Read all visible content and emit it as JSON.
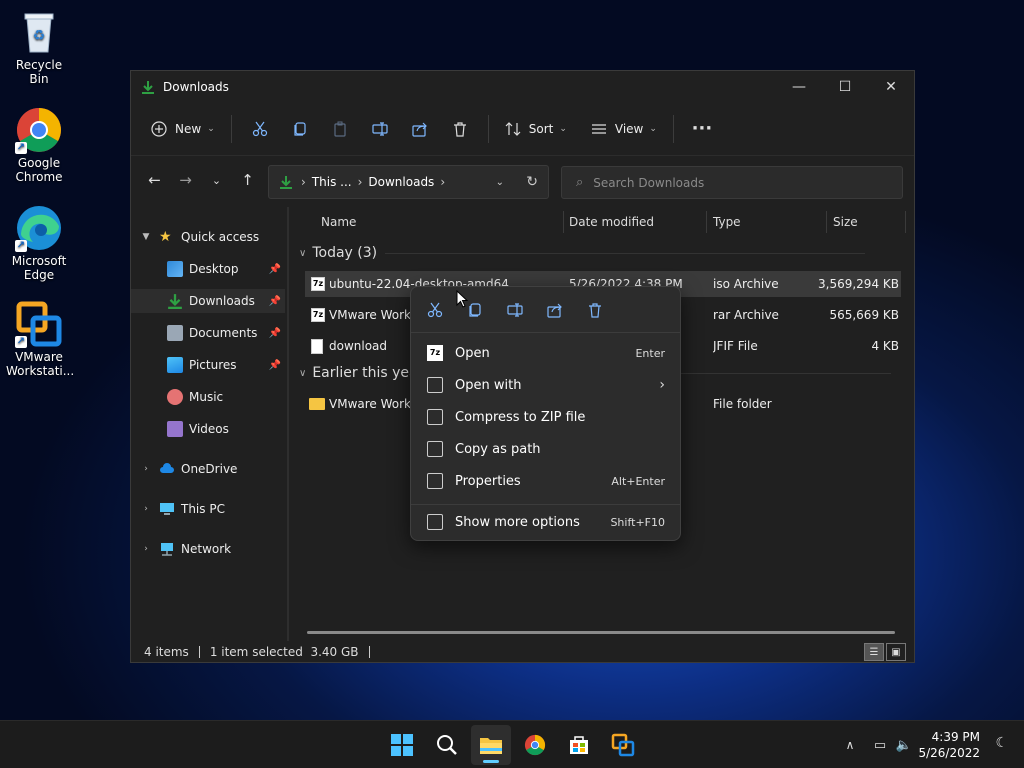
{
  "desktop": {
    "icons": [
      {
        "label": "Recycle Bin"
      },
      {
        "label": "Google Chrome"
      },
      {
        "label": "Microsoft Edge"
      },
      {
        "label": "VMware Workstati..."
      }
    ]
  },
  "window": {
    "title": "Downloads",
    "toolbar": {
      "new_label": "New",
      "sort_label": "Sort",
      "view_label": "View"
    },
    "address": {
      "crumb1": "This ...",
      "crumb2": "Downloads"
    },
    "search": {
      "placeholder": "Search Downloads"
    },
    "sidebar": {
      "quick_access": "Quick access",
      "items": [
        {
          "label": "Desktop"
        },
        {
          "label": "Downloads"
        },
        {
          "label": "Documents"
        },
        {
          "label": "Pictures"
        },
        {
          "label": "Music"
        },
        {
          "label": "Videos"
        }
      ],
      "onedrive": "OneDrive",
      "thispc": "This PC",
      "network": "Network"
    },
    "columns": {
      "name": "Name",
      "date": "Date modified",
      "type": "Type",
      "size": "Size"
    },
    "groups": {
      "today": "Today (3)",
      "earlier": "Earlier this year"
    },
    "files": [
      {
        "name": "ubuntu-22.04-desktop-amd64",
        "date": "5/26/2022 4:38 PM",
        "type": "iso Archive",
        "size": "3,569,294 KB"
      },
      {
        "name": "VMware Workst",
        "date": "",
        "type": "rar Archive",
        "size": "565,669 KB"
      },
      {
        "name": "download",
        "date": "",
        "type": "JFIF File",
        "size": "4 KB"
      },
      {
        "name": "VMware Workst",
        "date": "",
        "type": "File folder",
        "size": ""
      }
    ],
    "status": {
      "count": "4 items",
      "selected": "1 item selected  3.40 GB"
    }
  },
  "context_menu": {
    "items": [
      {
        "label": "Open",
        "shortcut": "Enter"
      },
      {
        "label": "Open with",
        "shortcut": ""
      },
      {
        "label": "Compress to ZIP file",
        "shortcut": ""
      },
      {
        "label": "Copy as path",
        "shortcut": ""
      },
      {
        "label": "Properties",
        "shortcut": "Alt+Enter"
      },
      {
        "label": "Show more options",
        "shortcut": "Shift+F10"
      }
    ]
  },
  "taskbar": {
    "time": "4:39 PM",
    "date": "5/26/2022"
  },
  "colors": {
    "accent": "#60cdff",
    "folder": "#f5c542",
    "green": "#2ea043"
  }
}
